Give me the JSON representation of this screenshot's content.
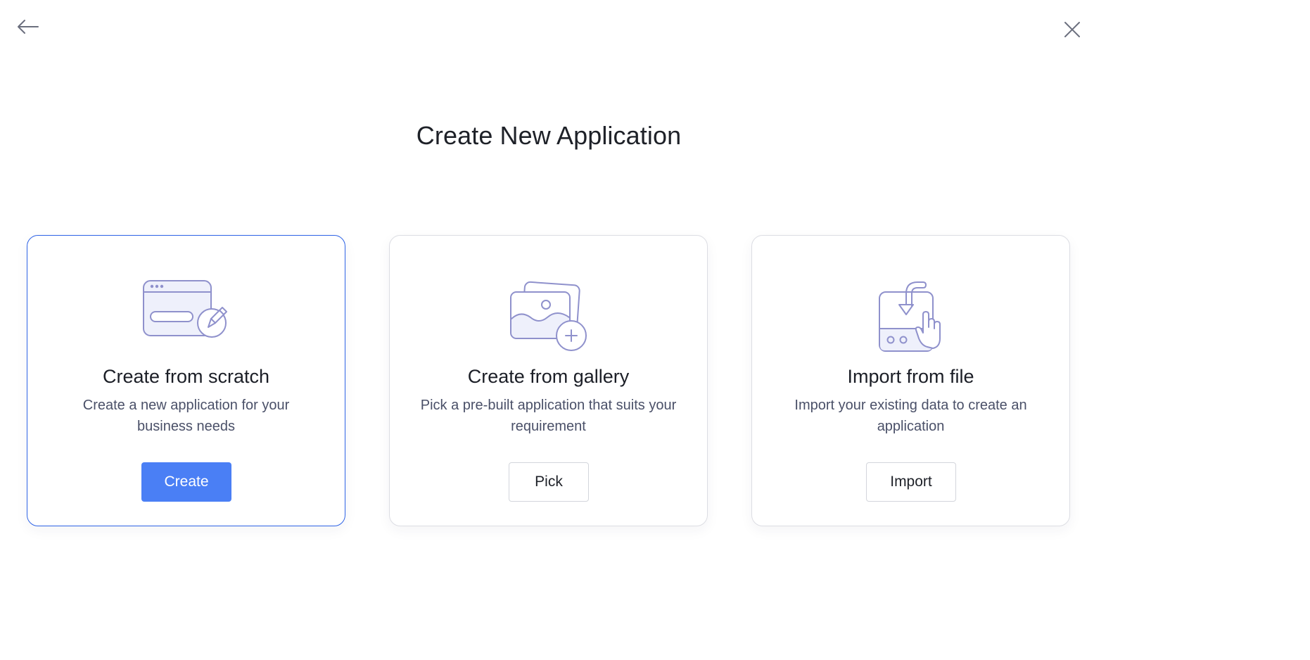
{
  "header": {
    "back_icon": "arrow-left-icon",
    "close_icon": "close-icon"
  },
  "title": "Create New Application",
  "cards": [
    {
      "icon": "browser-window-edit-icon",
      "title": "Create from scratch",
      "description": "Create a new application for your business needs",
      "button": "Create",
      "selected": true
    },
    {
      "icon": "image-gallery-add-icon",
      "title": "Create from gallery",
      "description": "Pick a pre-built application that suits your requirement",
      "button": "Pick",
      "selected": false
    },
    {
      "icon": "file-import-hand-icon",
      "title": "Import from file",
      "description": "Import your existing data to create an application",
      "button": "Import",
      "selected": false
    }
  ],
  "colors": {
    "accent": "#4a7ff5",
    "selected_border": "#2e63e6",
    "illustration_stroke": "#8f91cc",
    "illustration_fill": "#eef0fb"
  }
}
